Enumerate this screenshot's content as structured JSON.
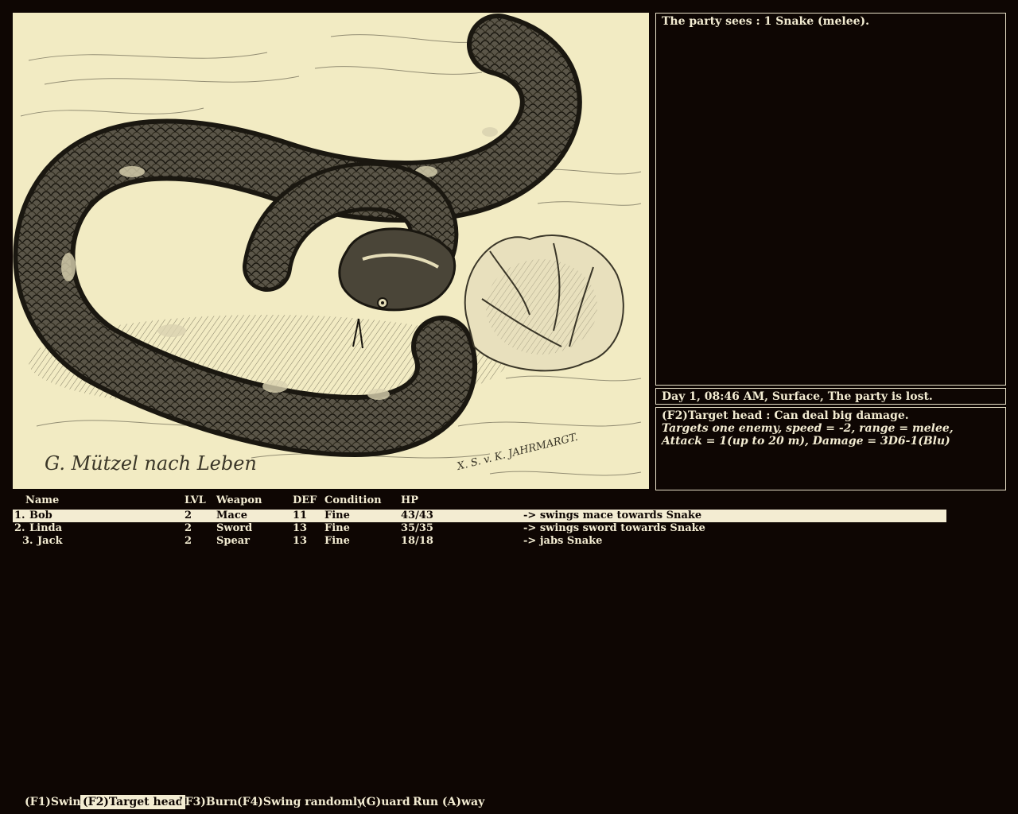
{
  "messages": {
    "encounter": "The party sees : 1 Snake (melee)."
  },
  "status": {
    "line": "Day 1, 08:46 AM, Surface, The party is lost."
  },
  "action_info": {
    "line1": "(F2)Target head : Can deal big damage.",
    "line2": "Targets one enemy,  speed = -2,  range = melee,",
    "line3": "Attack = 1(up to 20 m),  Damage = 3D6-1(Blu)"
  },
  "scene": {
    "subject": "snake",
    "signature_left": "G. Mützel nach Leben",
    "signature_right": "X. S. v. K. JAHRMARGT."
  },
  "roster": {
    "headers": {
      "name": "Name",
      "lvl": "LVL",
      "weapon": "Weapon",
      "def": "DEF",
      "condition": "Condition",
      "hp": "HP"
    },
    "members": [
      {
        "index": "1.",
        "name": "Bob",
        "lvl": "2",
        "weapon": "Mace",
        "def": "11",
        "condition": "Fine",
        "hp": "43/43",
        "action": "-> swings mace towards Snake"
      },
      {
        "index": "2.",
        "name": "Linda",
        "lvl": "2",
        "weapon": "Sword",
        "def": "13",
        "condition": "Fine",
        "hp": "35/35",
        "action": "-> swings sword towards Snake"
      },
      {
        "index": "3.",
        "name": "Jack",
        "lvl": "2",
        "weapon": "Spear",
        "def": "13",
        "condition": "Fine",
        "hp": "18/18",
        "action": "-> jabs Snake"
      }
    ]
  },
  "commands": [
    {
      "label": "(F1)Swing"
    },
    {
      "label": "(F2)Target head"
    },
    {
      "label": "(F3)Burn"
    },
    {
      "label": "(F4)Swing randomly"
    },
    {
      "label": "(G)uard"
    },
    {
      "label": "Run (A)way"
    }
  ],
  "colors": {
    "background": "#0e0603",
    "text": "#f3ecd2",
    "highlight": "#f3ecd2",
    "scene_paper": "#f2ebc3",
    "ink": "#1a1710"
  }
}
